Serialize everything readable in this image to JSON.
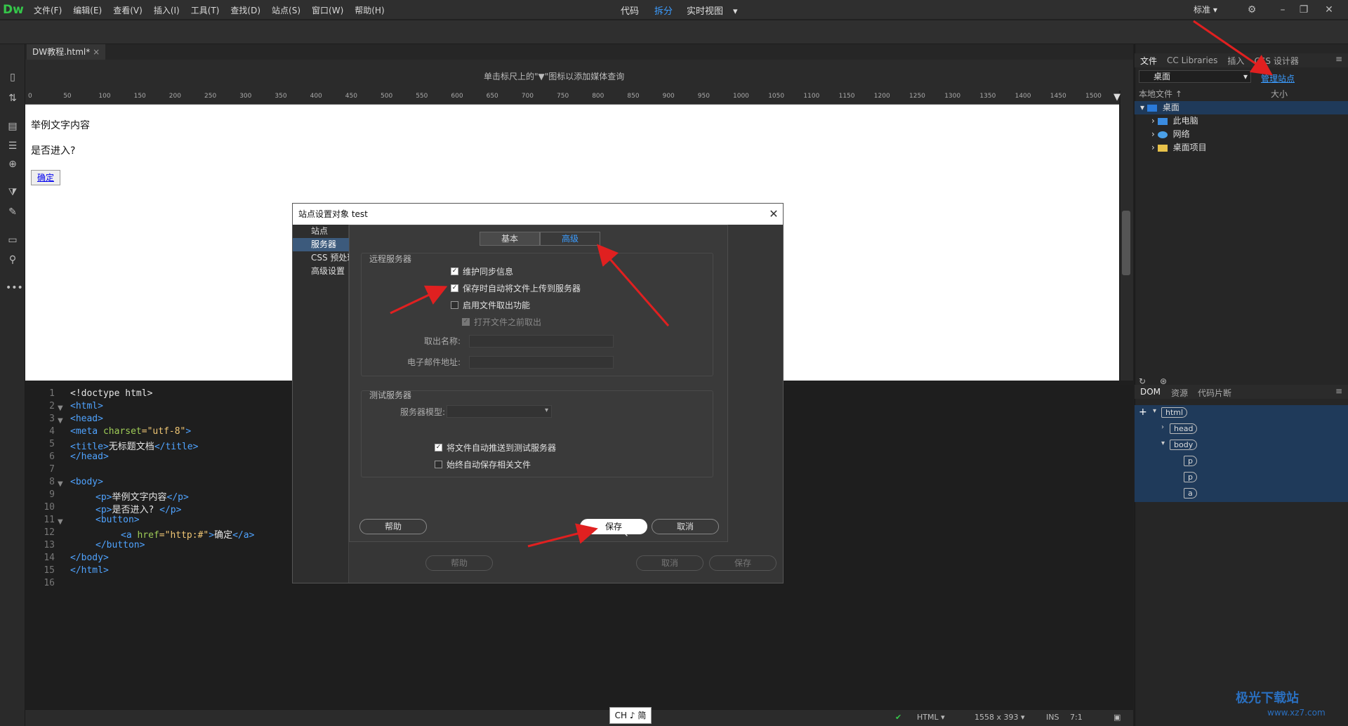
{
  "app": {
    "logo": "Dw"
  },
  "menu": [
    "文件(F)",
    "编辑(E)",
    "查看(V)",
    "插入(I)",
    "工具(T)",
    "查找(D)",
    "站点(S)",
    "窗口(W)",
    "帮助(H)"
  ],
  "workspace": "标准",
  "viewbar": {
    "code": "代码",
    "split": "拆分",
    "live": "实时视图"
  },
  "doc_tab": "DW教程.html*",
  "media_hint": "单击标尺上的\"▼\"图标以添加媒体查询",
  "ruler_ticks": [
    "0",
    "50",
    "100",
    "150",
    "200",
    "250",
    "300",
    "350",
    "400",
    "450",
    "500",
    "550",
    "600",
    "650",
    "700",
    "750",
    "800",
    "850",
    "900",
    "950",
    "1000",
    "1050",
    "1100",
    "1150",
    "1200",
    "1250",
    "1300",
    "1350",
    "1400",
    "1450",
    "1500"
  ],
  "design": {
    "p1": "举例文字内容",
    "p2": "是否进入?",
    "button": "确定"
  },
  "code_lines": [
    "1",
    "2",
    "3",
    "4",
    "5",
    "6",
    "7",
    "8",
    "9",
    "10",
    "11",
    "12",
    "13",
    "14",
    "15",
    "16"
  ],
  "code": {
    "l1": "<!doctype html>",
    "l2": "<html>",
    "l3": "<head>",
    "l4a": "<meta ",
    "l4b": "charset",
    "l4c": "=\"utf-8\"",
    "l4d": ">",
    "l5a": "<title>",
    "l5b": "无标题文档",
    "l5c": "</title>",
    "l6": "</head>",
    "l8": "<body>",
    "l9a": "<p>",
    "l9b": "举例文字内容",
    "l9c": "</p>",
    "l10a": "<p>",
    "l10b": "是否进入? ",
    "l10c": "</p>",
    "l11": "<button>",
    "l12a": "<a ",
    "l12b": "href",
    "l12c": "=\"http:#\"",
    "l12d": ">",
    "l12e": "确定",
    "l12f": "</a>",
    "l13": "</button>",
    "l14": "</body>",
    "l15": "</html>"
  },
  "status": {
    "lang": "HTML",
    "size": "1558 x 393",
    "mode": "INS",
    "pos": "7:1"
  },
  "ime": "CH ♪ 简",
  "right_panel": {
    "tabs": [
      "文件",
      "CC Libraries",
      "插入",
      "CSS 设计器"
    ],
    "location": "桌面",
    "manage": "管理站点",
    "col_local": "本地文件 ↑",
    "col_size": "大小",
    "tree": [
      "桌面",
      "此电脑",
      "网络",
      "桌面项目"
    ],
    "dom_tabs": [
      "DOM",
      "资源",
      "代码片断"
    ],
    "dom_tags": [
      "html",
      "head",
      "body",
      "p",
      "p",
      "a"
    ]
  },
  "outer_dialog": {
    "title": "站点设置对象 test",
    "side": [
      "站点",
      "服务器",
      "CSS 预处理器",
      "高级设置"
    ],
    "help": "帮助",
    "cancel": "取消",
    "save": "保存"
  },
  "inner_dialog": {
    "tabs": [
      "基本",
      "高级"
    ],
    "remote_group": "远程服务器",
    "cb1": "维护同步信息",
    "cb2": "保存时自动将文件上传到服务器",
    "cb3": "启用文件取出功能",
    "cb4": "打开文件之前取出",
    "checkout_name": "取出名称:",
    "email": "电子邮件地址:",
    "test_group": "测试服务器",
    "server_model": "服务器模型:",
    "cb5": "将文件自动推送到测试服务器",
    "cb6": "始终自动保存相关文件",
    "help": "帮助",
    "save": "保存",
    "cancel": "取消"
  },
  "watermark": {
    "name": "极光下载站",
    "url": "www.xz7.com"
  },
  "colors": {
    "accent": "#3b9cff",
    "arrow": "#e02020",
    "selection": "#3c5a7c"
  }
}
